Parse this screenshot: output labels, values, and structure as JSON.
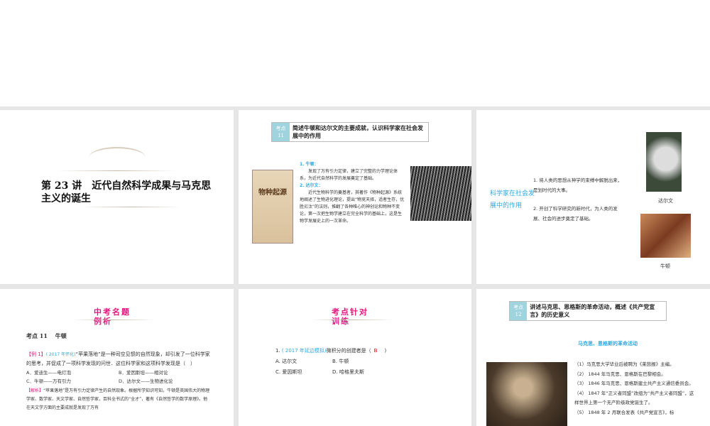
{
  "slides": [
    {
      "title": "第 23 讲　近代自然科学成果与马克思主义的诞生"
    },
    {
      "kd_num": "考点\n11",
      "kd_title": "简述牛顿和达尔文的主要成就，认识科学家在社会发展中的作用",
      "h1": "1. 牛顿：",
      "p1": "发现了万有引力定律，建立了完整的力学理论体系，为近代自然科学的发展奠定了基础。",
      "h2": "2. 达尔文：",
      "p2": "近代生物科学的奠基者，其著作《物种起源》系统地阐述了生物进化理论，提出“物竞天择，适者生存，优胜劣汰”的法则，推翻了各种唯心的神创论和物种不变论，第一次把生物学建立在完全科学的基础上，这是生物学发展史上的一次革命。",
      "book_title": "物种起源"
    },
    {
      "label": "科学家在社会发展中的作用",
      "p1": "1. 将人类的思想从神学的束缚中解脱出来，是划时代的大事。",
      "p2": "2. 开创了科学研究的新时代，为人类的发展、社会的进步奠定了基础。",
      "cap1": "达尔文",
      "cap2": "牛顿"
    },
    {
      "header1": "中考名题",
      "header2": "例析",
      "kd": "考点 11　 牛顿",
      "ex_label": "【例 1】",
      "ex_src": "( 2017 年怀化)",
      "ex_text": "“苹果落地”是一种司空见惯的自然现象，却引发了一位科学家的思考，并促成了一项科学发现的问世．这位科学家和这项科学发现是（　）",
      "options": [
        "A．爱迪生——电灯泡",
        "B．爱因斯坦——相对论",
        "C．牛顿——万有引力",
        "D．达尔文——生物进化论"
      ],
      "an_label": "【解析】",
      "an_text": "“苹果落地”是万有引力定律产生的自然现象。根据所学知识可知，牛顿是英国伟大的物理学家、数学家、天文学家、自然哲学家，百科全书式的“全才”，著有《自然哲学的数学原理》。他在天文学方面的主要成就是发现了万有"
    },
    {
      "header1": "考点针对",
      "header2": "训练",
      "q_num": "1.",
      "q_src": "( 2017 年延边模拟)",
      "q_text": "微积分的创建者是（",
      "q_ans": "B",
      "q_end": ")",
      "options": [
        "A. 达尔文",
        "B. 牛顿",
        "C. 爱因斯坦",
        "D. 哈格里夫斯"
      ]
    },
    {
      "kd_num": "考点\n12",
      "kd_title": "讲述马克思、恩格斯的革命活动，概述《共产党宣言》的历史意义",
      "subtitle": "马克思、恩格斯的革命活动",
      "items": [
        "（1）马克思大学毕业后被聘为《莱茵报》主编。",
        "（2） 1844 年马克思、恩格斯在巴黎相会。",
        "（3） 1846 年马克思、恩格斯建立共产主义通信委员会。",
        "（4） 1847 年“正义者同盟”改组为“共产主义者同盟”，这样世界上第一个无产阶级政党诞生了。",
        "（5） 1848 年 2 月联合发表《共产党宣言》，标"
      ]
    }
  ]
}
